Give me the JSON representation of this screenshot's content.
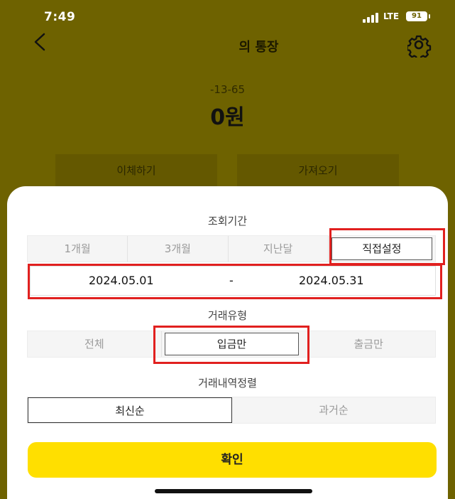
{
  "status": {
    "time": "7:49",
    "network": "LTE",
    "battery": "91"
  },
  "header": {
    "title": "의 통장",
    "back_icon": "chevron-left-icon",
    "settings_icon": "gear-icon"
  },
  "account": {
    "number": "-13-65",
    "balance": "0원"
  },
  "actions": {
    "transfer": "이체하기",
    "fetch": "가져오기"
  },
  "sheet": {
    "period_label": "조회기간",
    "period_options": [
      "1개월",
      "3개월",
      "지난달",
      "직접설정"
    ],
    "period_selected": "직접설정",
    "start_date": "2024.05.01",
    "date_separator": "-",
    "end_date": "2024.05.31",
    "type_label": "거래유형",
    "type_options": [
      "전체",
      "입금만",
      "출금만"
    ],
    "type_selected": "입금만",
    "sort_label": "거래내역정렬",
    "sort_options": [
      "최신순",
      "과거순"
    ],
    "sort_selected": "최신순",
    "confirm": "확인"
  },
  "colors": {
    "header_bg": "#6e6200",
    "confirm_bg": "#ffdf00",
    "highlight": "#e1201f"
  }
}
